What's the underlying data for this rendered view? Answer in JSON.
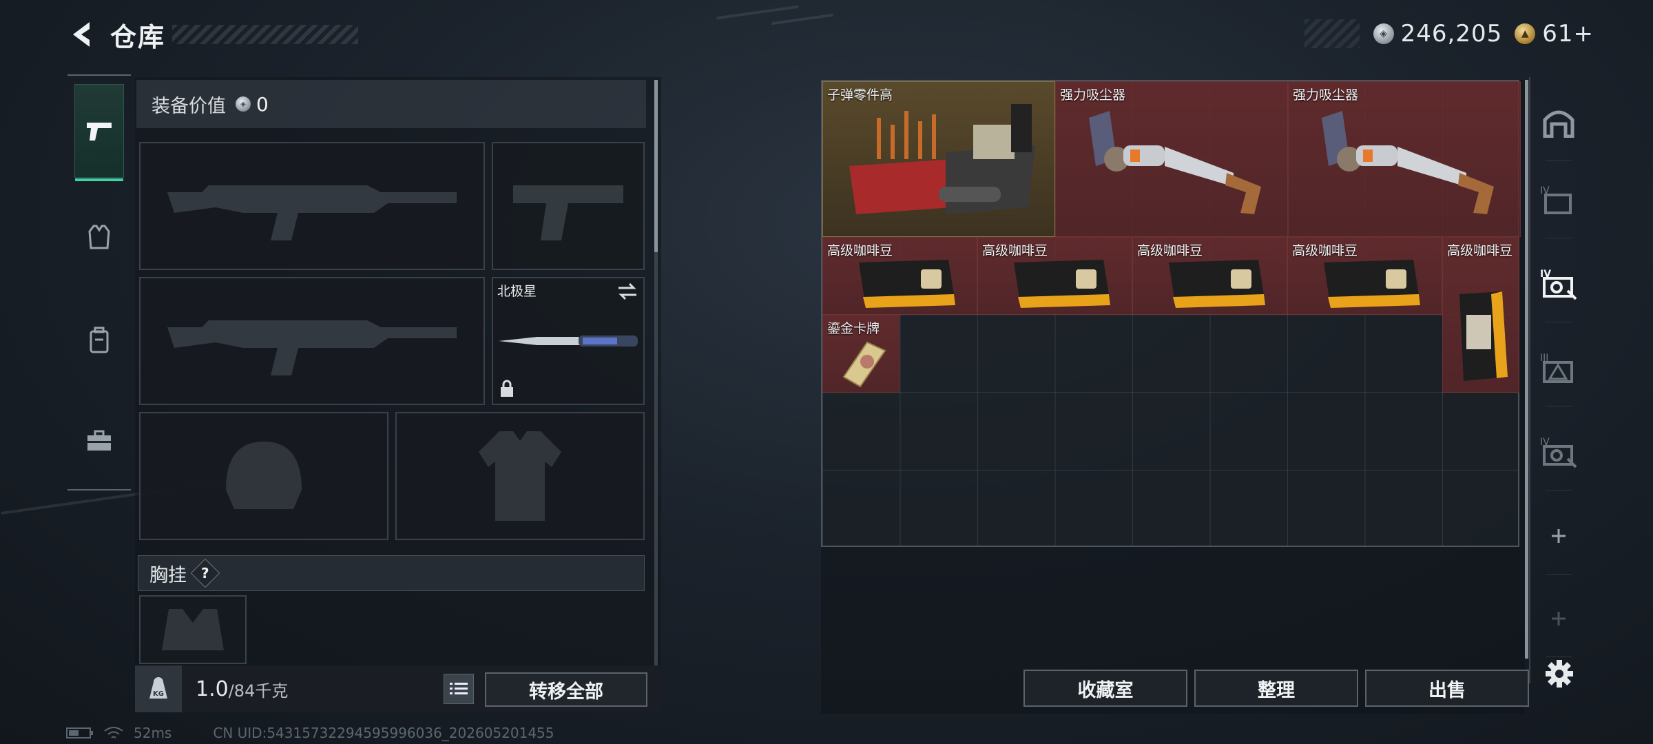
{
  "header": {
    "title": "仓库"
  },
  "currency": {
    "silver": "246,205",
    "gold": "61+"
  },
  "left_tabs": [
    {
      "name": "tab-weapons",
      "icon": "pistol-icon",
      "active": true
    },
    {
      "name": "tab-armor",
      "icon": "vest-icon",
      "active": false
    },
    {
      "name": "tab-backpack",
      "icon": "backpack-icon",
      "active": false
    },
    {
      "name": "tab-case",
      "icon": "briefcase-icon",
      "active": false
    }
  ],
  "equipment": {
    "value_label": "装备价值",
    "value": "0",
    "knife_slot": {
      "name": "北极星"
    },
    "chest_rig_label": "胸挂",
    "help": "?",
    "weight_current": "1.0",
    "weight_max": "/84千克",
    "transfer_all": "转移全部"
  },
  "storage": {
    "items": [
      {
        "name": "子弹零件高",
        "art": "ammo-parts-box",
        "color": "gold"
      },
      {
        "name": "强力吸尘器",
        "art": "vacuum-cleaner",
        "color": "red"
      },
      {
        "name": "强力吸尘器",
        "art": "vacuum-cleaner",
        "color": "red"
      },
      {
        "name": "高级咖啡豆",
        "art": "coffee-bag",
        "color": "red"
      },
      {
        "name": "高级咖啡豆",
        "art": "coffee-bag",
        "color": "red"
      },
      {
        "name": "高级咖啡豆",
        "art": "coffee-bag",
        "color": "red"
      },
      {
        "name": "高级咖啡豆",
        "art": "coffee-bag",
        "color": "red"
      },
      {
        "name": "高级咖啡豆",
        "art": "coffee-bag-tall",
        "color": "red"
      },
      {
        "name": "鎏金卡牌",
        "art": "gilded-card",
        "color": "red"
      }
    ],
    "buttons": {
      "collection": "收藏室",
      "organize": "整理",
      "sell": "出售"
    }
  },
  "right_tabs": [
    {
      "name": "tab-storage-main",
      "icon": "arch-icon"
    },
    {
      "name": "tab-storage-iv-a",
      "icon": "folder-iv-icon"
    },
    {
      "name": "tab-storage-iv-b",
      "icon": "wrench-iv-icon"
    },
    {
      "name": "tab-storage-iii",
      "icon": "warning-iii-icon"
    },
    {
      "name": "tab-storage-iv-c",
      "icon": "wrench-iv-icon"
    },
    {
      "name": "tab-add-1",
      "icon": "plus-icon"
    },
    {
      "name": "tab-add-2",
      "icon": "plus-icon"
    }
  ],
  "status": {
    "ping": "52ms",
    "uid": "CN UID:54315732294595996036_202605201455"
  },
  "colors": {
    "accent": "#3fd2a5",
    "item_red": "#6c2c2e",
    "item_gold": "#5a4a2c"
  }
}
